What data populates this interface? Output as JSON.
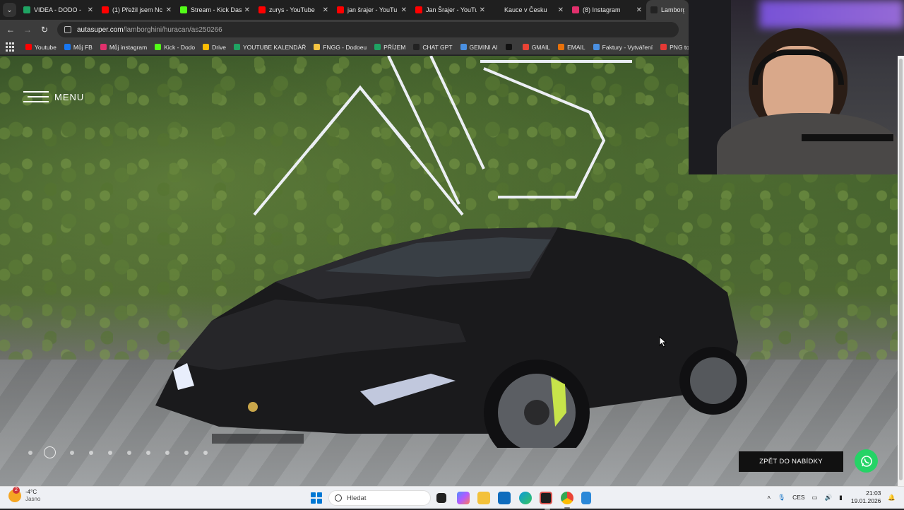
{
  "browser": {
    "tabs": [
      {
        "label": "VIDEA - DODO - ",
        "color": "#1fa463"
      },
      {
        "label": "(1) Přežil jsem Nc",
        "color": "#ff0000"
      },
      {
        "label": "Stream - Kick Das",
        "color": "#53fc18"
      },
      {
        "label": "zurys - YouTube",
        "color": "#ff0000"
      },
      {
        "label": "jan šrajer - YouTu",
        "color": "#ff0000"
      },
      {
        "label": "Jan Šrajer - YouTu",
        "color": "#ff0000"
      },
      {
        "label": "Kauce v Česku",
        "color": "#1f1f1f"
      },
      {
        "label": "(8) Instagram",
        "color": "#e1306c"
      },
      {
        "label": "Lamborghi",
        "color": "#222222"
      }
    ],
    "url": {
      "host": "autasuper.com",
      "path": "/lamborghini/huracan/as250266"
    },
    "bookmarks": [
      {
        "label": "Youtube",
        "color": "#ff0000"
      },
      {
        "label": "Můj FB",
        "color": "#1877f2"
      },
      {
        "label": "Můj instagram",
        "color": "#e1306c"
      },
      {
        "label": "Kick - Dodo",
        "color": "#53fc18"
      },
      {
        "label": "Drive",
        "color": "#fbbc04"
      },
      {
        "label": "YOUTUBE KALENDÁŘ",
        "color": "#1fa463"
      },
      {
        "label": "FNGG - Dodoeu",
        "color": "#f5c542"
      },
      {
        "label": "PŘÍJEM",
        "color": "#1fa463"
      },
      {
        "label": "CHAT GPT",
        "color": "#222222"
      },
      {
        "label": "GEMINI AI",
        "color": "#4a90e2"
      },
      {
        "label": "",
        "color": "#111111"
      },
      {
        "label": "GMAIL",
        "color": "#ea4335"
      },
      {
        "label": "EMAIL",
        "color": "#e8710a"
      },
      {
        "label": "Faktury - Vytváření",
        "color": "#4a90e2"
      },
      {
        "label": "PNG to PDF",
        "color": "#e53935"
      }
    ]
  },
  "page": {
    "menu_label": "MENU",
    "back_button": "ZPĚT DO NABÍDKY",
    "carousel": {
      "count": 10,
      "active_index": 1
    }
  },
  "taskbar": {
    "weather_temp": "-4°C",
    "weather_desc": "Jasno",
    "weather_badge": "2",
    "search_placeholder": "Hledat",
    "language": "CES",
    "time": "21:03",
    "date": "19.01.2026"
  }
}
